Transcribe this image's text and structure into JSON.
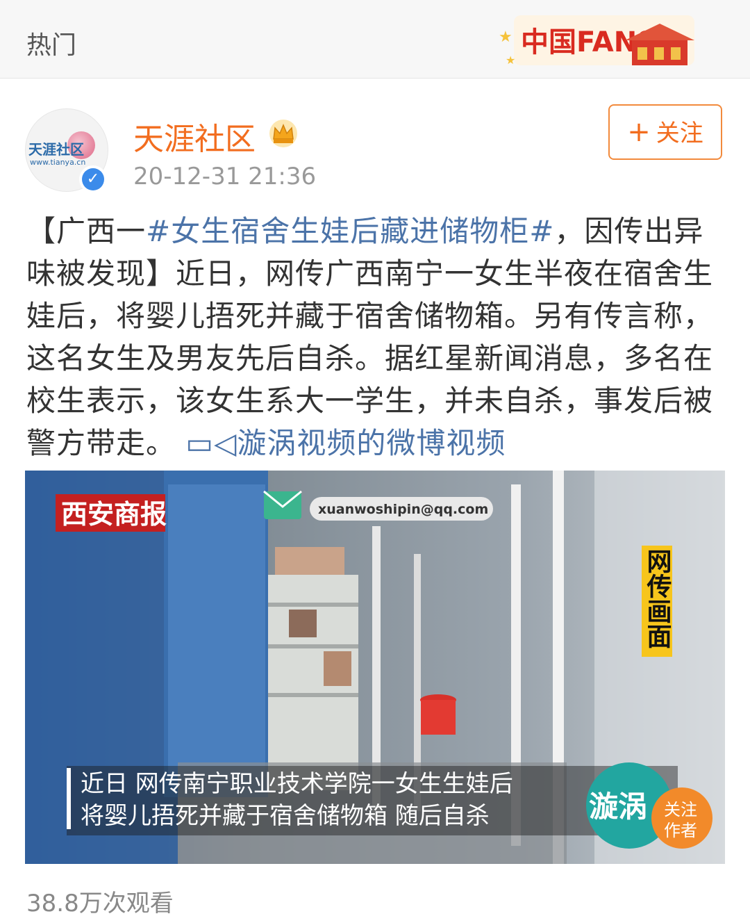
{
  "topbar": {
    "title": "热门",
    "banner_text": "中国FANS"
  },
  "post": {
    "avatar_text": "天涯社区",
    "avatar_url": "www.tianya.cn",
    "username": "天涯社区",
    "timestamp": "20-12-31 21:36",
    "follow_label": "关注",
    "text_prefix": "【广西一",
    "hashtag": "#女生宿舍生娃后藏进储物柜#",
    "text_body": "，因传出异味被发现】近日，网传广西南宁一女生半夜在宿舍生娃后，将婴儿捂死并藏于宿舍储物箱。另有传言称，这名女生及男友先后自杀。据红星新闻消息，多名在校生表示，该女生系大一学生，并未自杀，事发后被警方带走。",
    "video_link": "漩涡视频的微博视频"
  },
  "video": {
    "news_logo": "西安商报",
    "email": "xuanwoshipin@qq.com",
    "side_label": "网传画面",
    "subtitle_line1": "近日 网传南宁职业技术学院一女生生娃后",
    "subtitle_line2": "将婴儿捂死并藏于宿舍储物箱 随后自杀",
    "brand_logo": "漩涡",
    "follow_author_line1": "关注",
    "follow_author_line2": "作者"
  },
  "footer": {
    "views": "38.8万次观看"
  },
  "colors": {
    "accent": "#f26d1f",
    "link": "#4b73a8",
    "verified": "#3b8bea"
  }
}
